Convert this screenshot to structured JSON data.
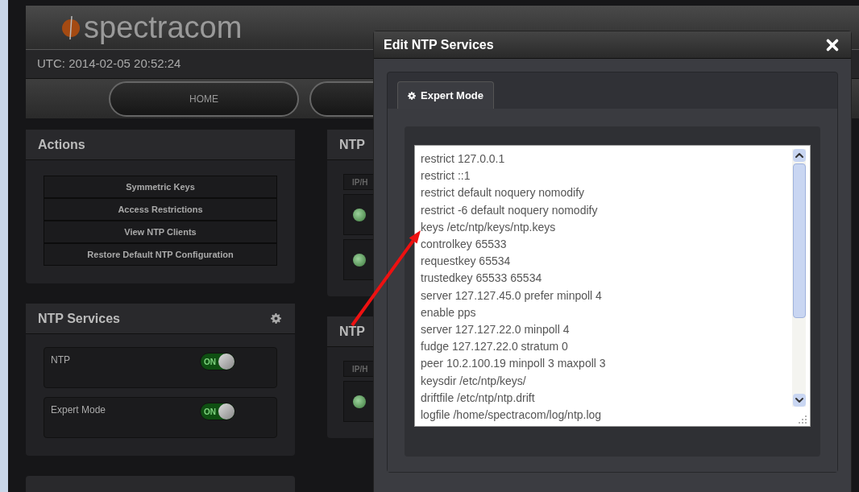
{
  "header": {
    "logo": "spectracom",
    "utc": "UTC: 2014-02-05 20:52:24",
    "nav_home": "HOME"
  },
  "actions": {
    "title": "Actions",
    "buttons": [
      "Symmetric Keys",
      "Access Restrictions",
      "View NTP Clients",
      "Restore Default NTP Configuration"
    ]
  },
  "ntp_services": {
    "title": "NTP Services",
    "toggles": [
      {
        "label": "NTP",
        "on": true,
        "state_label": "ON"
      },
      {
        "label": "Expert Mode",
        "on": true,
        "state_label": "ON"
      }
    ]
  },
  "background_panels": [
    {
      "title": "NTP",
      "column_header": "IP/H"
    },
    {
      "title": "NTP",
      "column_header": "IP/H"
    }
  ],
  "modal": {
    "title": "Edit NTP Services",
    "tabs": [
      {
        "label": "Expert Mode",
        "selected": true
      }
    ],
    "config_lines": [
      "restrict 127.0.0.1",
      "restrict ::1",
      "restrict default noquery nomodify",
      "restrict -6 default noquery nomodify",
      "keys /etc/ntp/keys/ntp.keys",
      "controlkey 65533",
      "requestkey 65534",
      "trustedkey 65533 65534",
      "server 127.127.45.0 prefer minpoll 4",
      "enable pps",
      "server 127.127.22.0 minpoll 4",
      "fudge 127.127.22.0 stratum 0",
      "peer 10.2.100.19 minpoll 3 maxpoll 3",
      "keysdir /etc/ntp/keys/",
      "driftfile /etc/ntp/ntp.drift",
      "logfile /home/spectracom/log/ntp.log"
    ]
  }
}
